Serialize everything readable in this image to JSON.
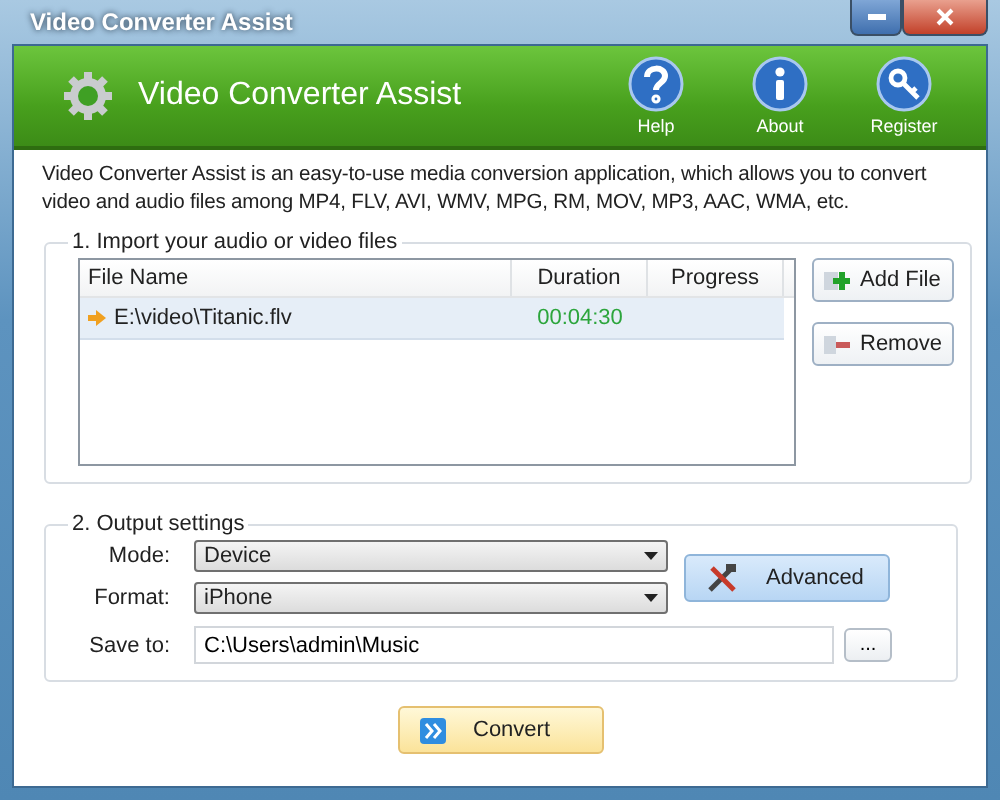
{
  "window": {
    "title": "Video Converter Assist"
  },
  "header": {
    "app_name": "Video Converter Assist",
    "actions": [
      {
        "kind": "help",
        "label": "Help"
      },
      {
        "kind": "about",
        "label": "About"
      },
      {
        "kind": "register",
        "label": "Register"
      }
    ]
  },
  "description": "Video Converter Assist is an easy-to-use media conversion application, which allows you to convert video and audio files among MP4, FLV, AVI, WMV, MPG, RM, MOV, MP3, AAC, WMA, etc.",
  "import": {
    "title": "1. Import your audio or video files",
    "columns": [
      "File Name",
      "Duration",
      "Progress"
    ],
    "rows": [
      {
        "file": "E:\\video\\Titanic.flv",
        "duration": "00:04:30",
        "selected": true
      }
    ],
    "buttons": [
      {
        "kind": "add",
        "label": "Add File"
      },
      {
        "kind": "remove",
        "label": "Remove"
      }
    ]
  },
  "output": {
    "title": "2. Output settings",
    "mode": {
      "label": "Mode:",
      "value": "Device"
    },
    "format": {
      "label": "Format:",
      "value": "iPhone"
    },
    "save_to": {
      "label": "Save to:",
      "value": "C:\\Users\\admin\\Music",
      "browse": "..."
    },
    "advanced": "Advanced"
  },
  "convert": "Convert"
}
